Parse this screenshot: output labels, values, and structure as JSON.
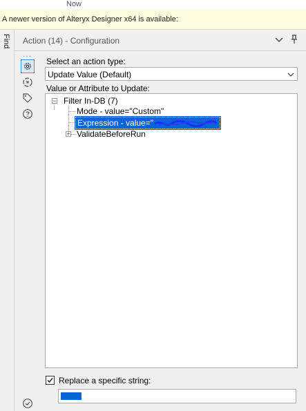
{
  "top": {
    "now_label": "Now"
  },
  "banner": {
    "text": "A newer version of Alteryx Designer x64 is available:"
  },
  "find_tab": {
    "label": "Find"
  },
  "panel": {
    "title": "Action (14) - Configuration"
  },
  "sidebar": {
    "icons": [
      "gear-icon",
      "workflow-icon",
      "tag-icon",
      "help-icon"
    ]
  },
  "action": {
    "label": "Select an action type:",
    "selected": "Update Value (Default)"
  },
  "attribute": {
    "label": "Value or Attribute to Update:",
    "tree": {
      "root": "Filter In-DB (7)",
      "children": [
        {
          "label": "Mode - value=\"Custom\""
        },
        {
          "label": "Expression - value=\"",
          "redacted": true,
          "selected": true
        },
        {
          "label": "ValidateBeforeRun",
          "expandable": true
        }
      ]
    }
  },
  "replace": {
    "label": "Replace a specific string:",
    "checked": true,
    "value_redacted": true
  },
  "colors": {
    "selection": "#0a64d4",
    "banner_bg": "#fffde0",
    "accent": "#4c8fd6"
  }
}
